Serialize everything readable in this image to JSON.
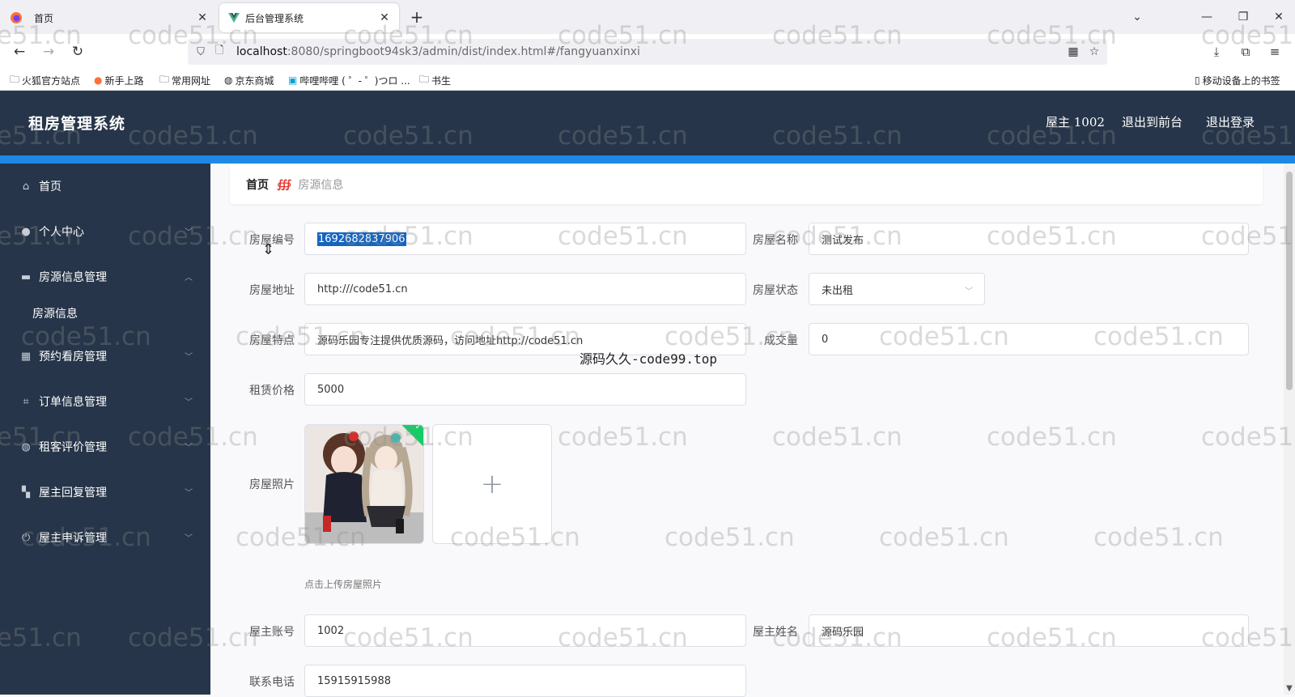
{
  "browser": {
    "tabs": [
      {
        "label": "首页",
        "active": false
      },
      {
        "label": "后台管理系统",
        "active": true
      }
    ],
    "url_host": "localhost",
    "url_path": ":8080/springboot94sk3/admin/dist/index.html#/fangyuanxinxi",
    "bookmarks": [
      "火狐官方站点",
      "新手上路",
      "常用网址",
      "京东商城",
      "哔哩哔哩 ( ゜- ゜)つロ ...",
      "书生"
    ],
    "mobile_bookmarks": "移动设备上的书签"
  },
  "header": {
    "title": "租房管理系统",
    "user": "屋主 1002",
    "to_front": "退出到前台",
    "logout": "退出登录"
  },
  "sidebar": {
    "items": [
      {
        "label": "首页",
        "icon": "home-icon"
      },
      {
        "label": "个人中心",
        "icon": "user-icon"
      },
      {
        "label": "房源信息管理",
        "icon": "monitor-icon",
        "expanded": true
      },
      {
        "label": "房源信息",
        "sub": true
      },
      {
        "label": "预约看房管理",
        "icon": "grid-icon"
      },
      {
        "label": "订单信息管理",
        "icon": "crop-icon"
      },
      {
        "label": "租客评价管理",
        "icon": "globe-icon"
      },
      {
        "label": "屋主回复管理",
        "icon": "apps-icon"
      },
      {
        "label": "屋主申诉管理",
        "icon": "power-icon"
      }
    ]
  },
  "breadcrumb": {
    "home": "首页",
    "current": "房源信息"
  },
  "form": {
    "house_no_label": "房屋编号",
    "house_no": "1692682837906",
    "house_name_label": "房屋名称",
    "house_name": "测试发布",
    "address_label": "房屋地址",
    "address": "http:///code51.cn",
    "status_label": "房屋状态",
    "status": "未出租",
    "feature_label": "房屋特点",
    "feature": "源码乐园专注提供优质源码，访问地址http://code51.cn",
    "deals_label": "成交量",
    "deals": "0",
    "price_label": "租赁价格",
    "price": "5000",
    "photo_label": "房屋照片",
    "photo_tip": "点击上传房屋照片",
    "owner_account_label": "屋主账号",
    "owner_account": "1002",
    "owner_name_label": "屋主姓名",
    "owner_name": "源码乐园",
    "phone_label": "联系电话",
    "phone": "15915915988"
  },
  "overlay_watermark": "源码久久-code99.top",
  "watermark_text": "code51.cn",
  "colors": {
    "header_bg": "#263549",
    "accent": "#1e88e5",
    "selection": "#1565c0"
  }
}
